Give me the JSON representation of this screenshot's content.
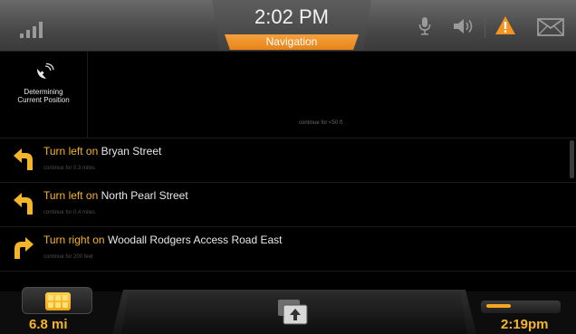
{
  "header": {
    "time": "2:02 PM",
    "tab_label": "Navigation",
    "signal_icon": "signal-bars-icon",
    "mic_icon": "microphone-icon",
    "volume_icon": "speaker-icon",
    "alert_icon": "warning-icon",
    "message_icon": "envelope-icon"
  },
  "position_status": {
    "line1": "Determining",
    "line2": "Current Position",
    "icon": "satellite-dish-icon",
    "upcoming_hint": "continue for <50 ft"
  },
  "turns": [
    {
      "direction": "left",
      "verb": "Turn left",
      "connector": "on",
      "street": "Bryan Street",
      "subtext": "continue for 0.3 miles"
    },
    {
      "direction": "left",
      "verb": "Turn left",
      "connector": "on",
      "street": "North Pearl Street",
      "subtext": "continue for 0.4 miles"
    },
    {
      "direction": "right",
      "verb": "Turn right",
      "connector": "on",
      "street": "Woodall Rodgers Access Road East",
      "subtext": "continue for 200 feet"
    }
  ],
  "bottom": {
    "distance": "6.8 mi",
    "eta": "2:19pm",
    "menu_icon": "grid-menu-icon",
    "expand_icon": "expand-up-icon",
    "progress": 0.35
  },
  "colors": {
    "accent": "#f5b52a",
    "tab": "#ee8e22",
    "alert": "#f7931e"
  }
}
